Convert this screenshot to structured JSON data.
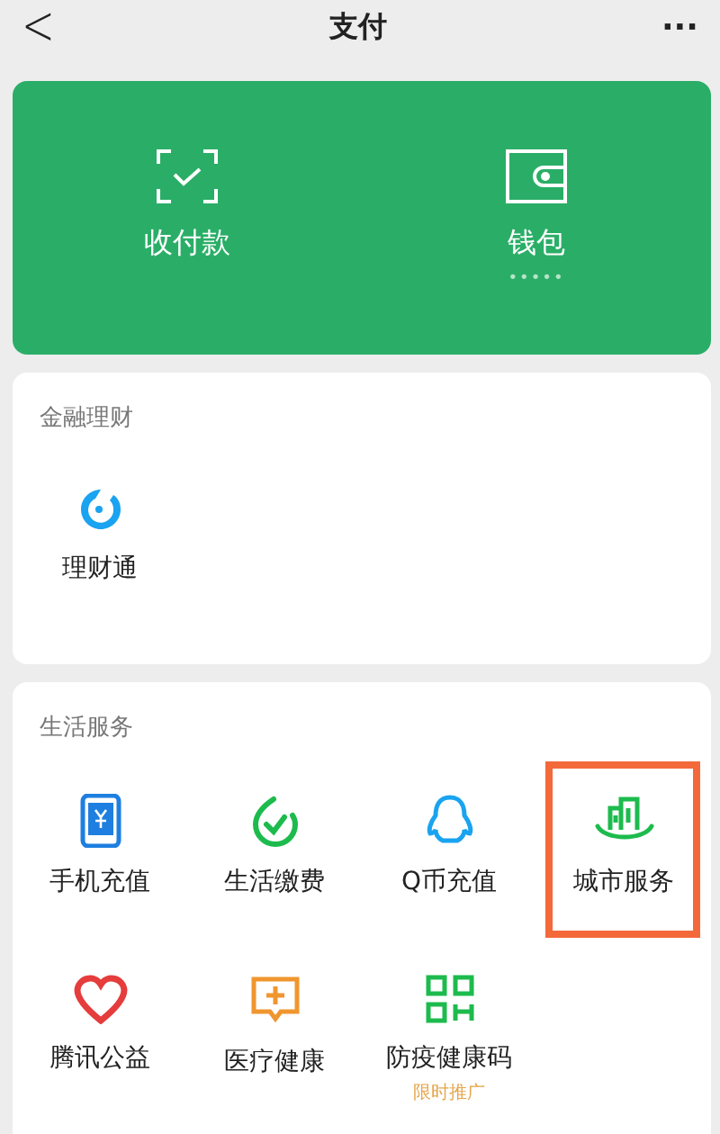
{
  "header": {
    "back": "<",
    "title": "支付",
    "more": "···"
  },
  "top_card": {
    "items": [
      {
        "kind": "scan",
        "label": "收付款"
      },
      {
        "kind": "wallet",
        "label": "钱包",
        "sub": "•••••"
      }
    ]
  },
  "sections": [
    {
      "title": "金融理财",
      "items": [
        {
          "kind": "licaitong",
          "label": "理财通",
          "highlighted": false
        }
      ]
    },
    {
      "title": "生活服务",
      "items": [
        {
          "kind": "phone",
          "label": "手机充值",
          "highlighted": false
        },
        {
          "kind": "utility",
          "label": "生活缴费",
          "highlighted": false
        },
        {
          "kind": "qq",
          "label": "Q币充值",
          "highlighted": false
        },
        {
          "kind": "city",
          "label": "城市服务",
          "highlighted": true
        },
        {
          "kind": "charity",
          "label": "腾讯公益",
          "highlighted": false
        },
        {
          "kind": "medical",
          "label": "医疗健康",
          "highlighted": false
        },
        {
          "kind": "qrcode",
          "label": "防疫健康码",
          "badge": "限时推广",
          "highlighted": false
        }
      ]
    }
  ]
}
